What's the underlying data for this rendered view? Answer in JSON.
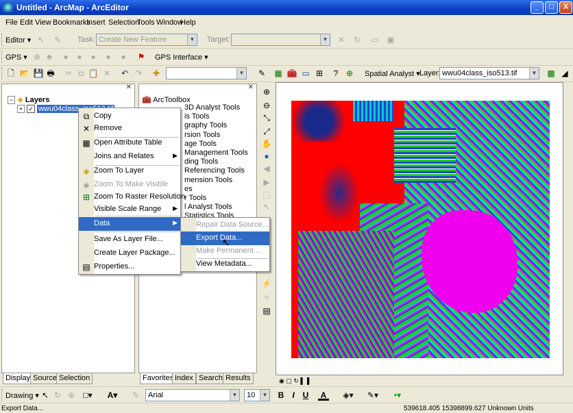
{
  "window": {
    "title": "Untitled - ArcMap - ArcEditor",
    "minimize": "_",
    "maximize": "□",
    "close": "X"
  },
  "menubar": [
    "File",
    "Edit",
    "View",
    "Bookmarks",
    "Insert",
    "Selection",
    "Tools",
    "Window",
    "Help"
  ],
  "editor_toolbar": {
    "editor_label": "Editor ▾",
    "task_label": "Task:",
    "task_value": "Create New Feature",
    "target_label": "Target:",
    "target_value": ""
  },
  "gps_toolbar": {
    "gps_label": "GPS ▾",
    "gps_interface_label": "GPS Interface ▾"
  },
  "standard_toolbar": {
    "combo_value": "",
    "spatial_analyst_label": "Spatial Analyst ▾",
    "layer_label": "Layer:",
    "layer_value": "wwu04class_iso513.tif"
  },
  "toc": {
    "root": "Layers",
    "layer": "wwu04class_iso513.tif",
    "tabs": [
      "Display",
      "Source",
      "Selection"
    ]
  },
  "arctoolbox": {
    "root": "ArcToolbox",
    "items": [
      "3D Analyst Tools",
      "is Tools",
      "graphy Tools",
      "rsion Tools",
      "age Tools",
      "Management Tools",
      "ding Tools",
      "Referencing Tools",
      "mension Tools",
      "es",
      "r Tools",
      "l Analyst Tools",
      "Statistics Tools"
    ],
    "tabs": [
      "Favorites",
      "Index",
      "Search",
      "Results"
    ]
  },
  "context_menu": {
    "items": [
      {
        "label": "Copy",
        "icon": "copy-icon",
        "enabled": true
      },
      {
        "label": "Remove",
        "icon": "remove-x-icon",
        "enabled": true
      },
      {
        "label": "Open Attribute Table",
        "icon": "table-icon",
        "enabled": true
      },
      {
        "label": "Joins and Relates",
        "icon": "",
        "enabled": true,
        "submenu": true
      },
      {
        "label": "Zoom To Layer",
        "icon": "zoom-layer-icon",
        "enabled": true
      },
      {
        "label": "Zoom To Make Visible",
        "icon": "zoom-visible-icon",
        "enabled": false
      },
      {
        "label": "Zoom To Raster Resolution",
        "icon": "raster-resolution-icon",
        "enabled": true
      },
      {
        "label": "Visible Scale Range",
        "icon": "",
        "enabled": true,
        "submenu": true
      },
      {
        "label": "Data",
        "icon": "",
        "enabled": true,
        "submenu": true,
        "highlighted": true
      },
      {
        "label": "Save As Layer File...",
        "icon": "",
        "enabled": true
      },
      {
        "label": "Create Layer Package...",
        "icon": "",
        "enabled": true
      },
      {
        "label": "Properties...",
        "icon": "properties-icon",
        "enabled": true
      }
    ]
  },
  "data_submenu": {
    "items": [
      {
        "label": "Repair Data Source...",
        "enabled": false
      },
      {
        "label": "Export Data...",
        "enabled": true,
        "highlighted": true
      },
      {
        "label": "Make Permanent...",
        "enabled": false
      },
      {
        "label": "View Metadata...",
        "enabled": true
      }
    ]
  },
  "draw_toolbar": {
    "drawing_label": "Drawing ▾",
    "font_name": "Arial",
    "font_size": "10"
  },
  "statusbar": {
    "message": "Export Data...",
    "coordinates": "539618.405  15398899.627 Unknown Units"
  },
  "colors": {
    "titlebar": "#0a3fc2",
    "menu_highlight": "#316ac5",
    "raster_red": "#ff0000",
    "raster_magenta": "#ff00ff",
    "raster_green": "#22cc22",
    "raster_blue": "#2244cc"
  }
}
